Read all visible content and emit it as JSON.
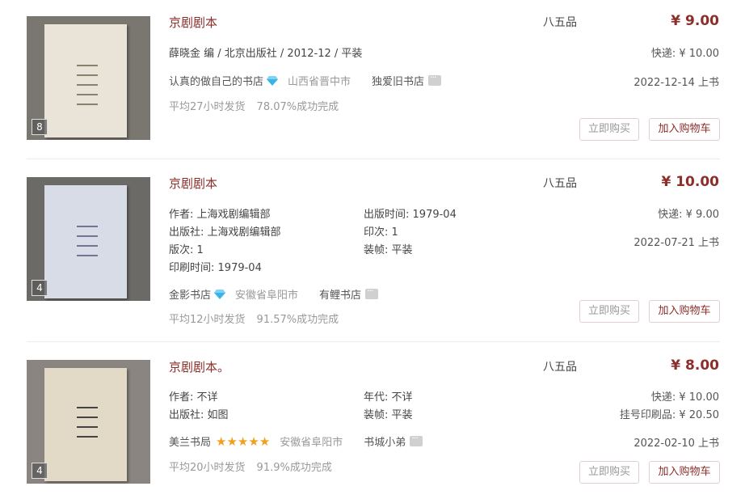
{
  "items": [
    {
      "title": "京剧剧本",
      "grade": "八五品",
      "price": "¥ 9.00",
      "meta": "薛晓金 编 / 北京出版社 / 2012-12 / 平装",
      "shipping": "快递: ¥ 10.00",
      "shop": "认真的做自己的书店",
      "location": "山西省晋中市",
      "seller": "独爱旧书店",
      "date": "2022-12-14 上书",
      "avg_ship": "平均27小时发货",
      "success": "78.07%成功完成",
      "image_count": "8",
      "buy_label": "立即购买",
      "cart_label": "加入购物车"
    },
    {
      "title": "京剧剧本",
      "grade": "八五品",
      "price": "¥ 10.00",
      "author_k": "作者:",
      "author_v": "上海戏剧编辑部",
      "pubtime_k": "出版时间:",
      "pubtime_v": "1979-04",
      "publisher_k": "出版社:",
      "publisher_v": "上海戏剧编辑部",
      "print_k": "印次:",
      "print_v": "1",
      "edition_k": "版次:",
      "edition_v": "1",
      "binding_k": "装帧:",
      "binding_v": "平装",
      "printtime_k": "印刷时间:",
      "printtime_v": "1979-04",
      "shipping": "快递: ¥ 9.00",
      "date": "2022-07-21 上书",
      "shop": "金影书店",
      "location": "安徽省阜阳市",
      "seller": "有鲤书店",
      "avg_ship": "平均12小时发货",
      "success": "91.57%成功完成",
      "image_count": "4",
      "buy_label": "立即购买",
      "cart_label": "加入购物车"
    },
    {
      "title": "京剧剧本。",
      "grade": "八五品",
      "price": "¥ 8.00",
      "author_k": "作者:",
      "author_v": "不详",
      "year_k": "年代:",
      "year_v": "不详",
      "publisher_k": "出版社:",
      "publisher_v": "如图",
      "binding_k": "装帧:",
      "binding_v": "平装",
      "shipping": "快递: ¥ 10.00",
      "registered": "挂号印刷品: ¥ 20.50",
      "shop": "美兰书局",
      "location": "安徽省阜阳市",
      "seller": "书城小弟",
      "date": "2022-02-10 上书",
      "avg_ship": "平均20小时发货",
      "success": "91.9%成功完成",
      "image_count": "4",
      "rating": 5,
      "buy_label": "立即购买",
      "cart_label": "加入购物车"
    }
  ],
  "colors": {
    "accent": "#8c2f2a",
    "muted": "#999999",
    "gem": "#3ab4e6",
    "star": "#f0a01c"
  }
}
